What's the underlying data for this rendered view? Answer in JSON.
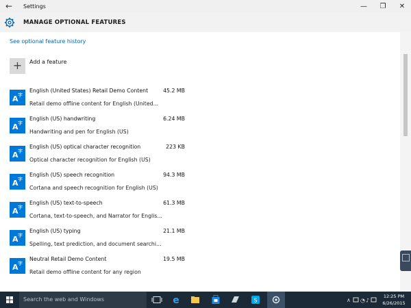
{
  "window": {
    "title": "Settings",
    "back_glyph": "←",
    "minimize_glyph": "—",
    "maximize_glyph": "❐",
    "close_glyph": "✕"
  },
  "header": {
    "title": "MANAGE OPTIONAL FEATURES",
    "icon": "gear-icon"
  },
  "content": {
    "history_link": "See optional feature history",
    "add_feature": {
      "label": "Add a feature",
      "glyph": "+"
    },
    "features": [
      {
        "name": "English (United States) Retail Demo Content",
        "size": "45.2 MB",
        "description": "Retail demo offline content for English (United..."
      },
      {
        "name": "English (US) handwriting",
        "size": "6.24 MB",
        "description": "Handwriting and pen for English (US)"
      },
      {
        "name": "English (US) optical character recognition",
        "size": "223 KB",
        "description": "Optical character recognition for English (US)"
      },
      {
        "name": "English (US) speech recognition",
        "size": "94.3 MB",
        "description": "Cortana and speech recognition for English (US)"
      },
      {
        "name": "English (US) text-to-speech",
        "size": "61.3 MB",
        "description": "Cortana, text-to-speech, and Narrator for Englis..."
      },
      {
        "name": "English (US) typing",
        "size": "21.1 MB",
        "description": "Spelling, text prediction, and document searchi..."
      },
      {
        "name": "Neutral Retail Demo Content",
        "size": "19.5 MB",
        "description": "Retail demo offline content for any region"
      }
    ]
  },
  "taskbar": {
    "search_placeholder": "Search the web and Windows",
    "time": "12:25 PM",
    "date": "6/26/2015",
    "colors": {
      "taskbar": "#1b2a36",
      "accent": "#0078d7"
    }
  }
}
